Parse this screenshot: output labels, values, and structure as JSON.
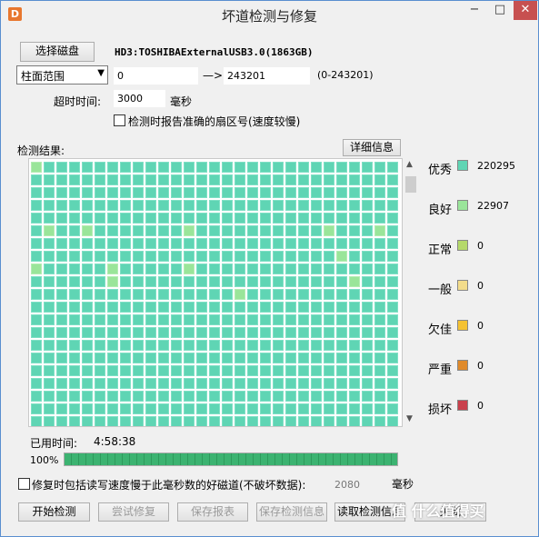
{
  "window": {
    "title": "坏道检测与修复",
    "min": "−",
    "max": "□",
    "close": "✕"
  },
  "top": {
    "select_disk_label": "选择磁盘",
    "disk_info": "HD3:TOSHIBAExternalUSB3.0(1863GB)",
    "range_mode": "柱面范围",
    "range_start": "0",
    "arrow": "—>",
    "range_end": "243201",
    "range_hint": "(0-243201)",
    "timeout_label": "超时时间:",
    "timeout_value": "3000",
    "timeout_unit": "毫秒",
    "accurate_label": "检测时报告准确的扇区号(速度较慢)"
  },
  "result": {
    "title": "检测结果:",
    "details_button": "详细信息"
  },
  "grid": {
    "columns": 29,
    "rows": 21,
    "good_cells": [
      0,
      146,
      149,
      157,
      168,
      172,
      227,
      232,
      238,
      244,
      267,
      286,
      306
    ]
  },
  "legend": [
    {
      "name": "优秀",
      "color": "#5fd5b4",
      "count": "220295"
    },
    {
      "name": "良好",
      "color": "#9ae59a",
      "count": "22907"
    },
    {
      "name": "正常",
      "color": "#b5d96a",
      "count": "0"
    },
    {
      "name": "一般",
      "color": "#f3dc8a",
      "count": "0"
    },
    {
      "name": "欠佳",
      "color": "#f5c232",
      "count": "0"
    },
    {
      "name": "严重",
      "color": "#e08a2a",
      "count": "0"
    },
    {
      "name": "损坏",
      "color": "#c9404c",
      "count": "0"
    }
  ],
  "status": {
    "elapsed_label": "已用时间:",
    "elapsed_value": "4:58:38",
    "percent_label": "100%",
    "progress": 1.0
  },
  "repair_option": {
    "label": "修复时包括读写速度慢于此毫秒数的好磁道(不破坏数据):",
    "value": "2080",
    "unit": "毫秒"
  },
  "buttons": {
    "start": "开始检测",
    "try_repair": "尝试修复",
    "save_report": "保存报表",
    "save_info": "保存检测信息",
    "read_info": "读取检测信息",
    "close": "关闭"
  },
  "watermark": "值 什么值得买"
}
